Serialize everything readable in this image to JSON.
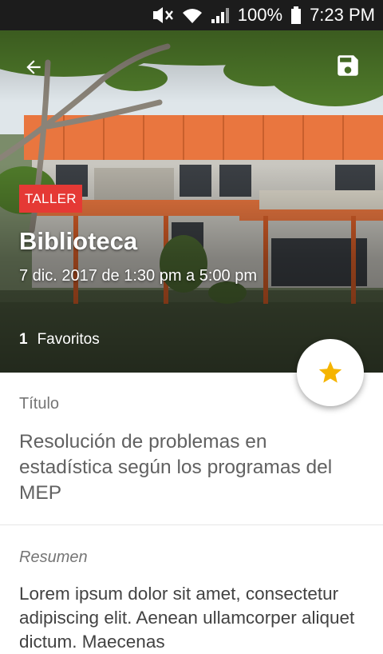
{
  "status_bar": {
    "battery": "100%",
    "time": "7:23 PM"
  },
  "event": {
    "tag": "TALLER",
    "place": "Biblioteca",
    "datetime": "7 dic. 2017 de 1:30 pm a 5:00 pm",
    "favorites_count": "1",
    "favorites_label": "Favoritos",
    "title_label": "Título",
    "title": "Resolución de problemas en estadística según los programas del MEP",
    "summary_label": "Resumen",
    "summary": "Lorem ipsum dolor sit amet, consectetur adipiscing elit. Aenean ullamcorper aliquet dictum. Maecenas"
  },
  "icons": {
    "back": "arrow-back-icon",
    "save": "save-icon",
    "favorite": "star-icon"
  },
  "colors": {
    "tag_bg": "#e53935",
    "star": "#f5b400",
    "status_bar_bg": "#1c1c1c"
  }
}
